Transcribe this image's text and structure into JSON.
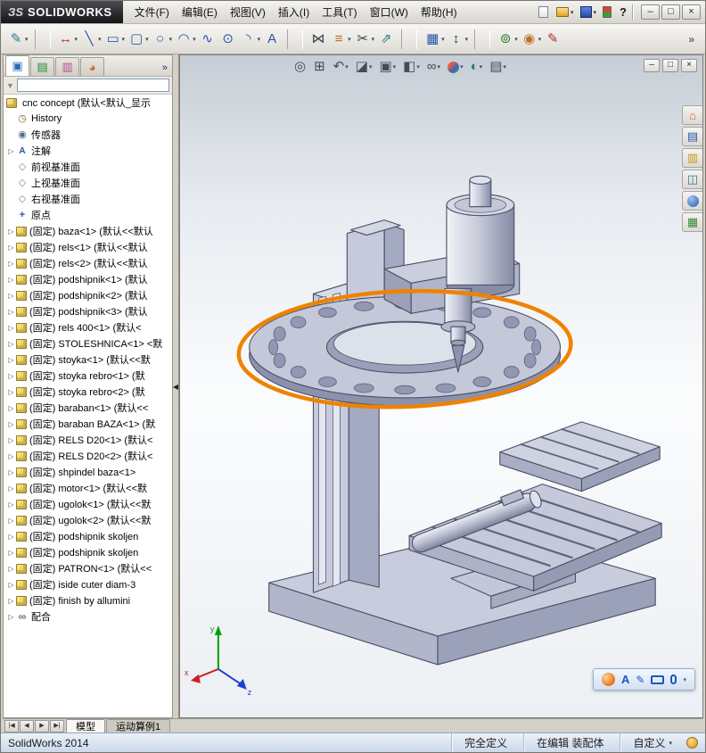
{
  "app": {
    "logo_mark": "ЗS",
    "logo_text": "SOLIDWORKS"
  },
  "menubar": {
    "items": [
      "文件(F)",
      "编辑(E)",
      "视图(V)",
      "插入(I)",
      "工具(T)",
      "窗口(W)",
      "帮助(H)"
    ]
  },
  "qat": {
    "items": [
      {
        "name": "new-document-button",
        "cls": "qi-page",
        "glyph": "",
        "dd": ""
      },
      {
        "name": "open-button",
        "cls": "qi-folder",
        "glyph": "",
        "dd": "▾"
      },
      {
        "name": "save-button",
        "cls": "qi-save",
        "glyph": "",
        "dd": "▾"
      },
      {
        "name": "options-toggle-button",
        "cls": "qi-toggle",
        "glyph": "",
        "dd": ""
      },
      {
        "name": "help-button",
        "cls": "qi-help",
        "glyph": "?",
        "dd": ""
      }
    ]
  },
  "window_controls": [
    {
      "name": "minimize-button",
      "glyph": "–"
    },
    {
      "name": "maximize-button",
      "glyph": "□"
    },
    {
      "name": "close-button",
      "glyph": "×"
    }
  ],
  "sketch_toolbar": {
    "overflow": "»",
    "items": [
      {
        "name": "sketch-button",
        "glyph": "✎",
        "arrow": "▾",
        "cls": "c-teal"
      },
      {
        "name": "separator",
        "glyph": "",
        "arrow": "",
        "cls": "tsepv"
      },
      {
        "name": "smart-dimension-button",
        "glyph": "↔",
        "arrow": "▾",
        "cls": "c-red"
      },
      {
        "name": "line-button",
        "glyph": "╲",
        "arrow": "▾",
        "cls": "c-blue"
      },
      {
        "name": "rectangle-button",
        "glyph": "▭",
        "arrow": "▾",
        "cls": "c-blue"
      },
      {
        "name": "slot-button",
        "glyph": "▢",
        "arrow": "▾",
        "cls": "c-blue"
      },
      {
        "name": "circle-button",
        "glyph": "○",
        "arrow": "▾",
        "cls": "c-blue"
      },
      {
        "name": "arc-button",
        "glyph": "◠",
        "arrow": "▾",
        "cls": "c-blue"
      },
      {
        "name": "spline-button",
        "glyph": "∿",
        "arrow": "",
        "cls": "c-blue"
      },
      {
        "name": "ellipse-button",
        "glyph": "⊙",
        "arrow": "",
        "cls": "c-blue"
      },
      {
        "name": "fillet-button",
        "glyph": "◝",
        "arrow": "▾",
        "cls": "c-blue"
      },
      {
        "name": "text-button",
        "glyph": "A",
        "arrow": "",
        "cls": "c-blue"
      },
      {
        "name": "separator",
        "glyph": "",
        "arrow": "",
        "cls": "tsepv"
      },
      {
        "name": "mirror-entities-button",
        "glyph": "⋈",
        "arrow": "",
        "cls": "c-dark"
      },
      {
        "name": "offset-entities-button",
        "glyph": "≡",
        "arrow": "▾",
        "cls": "c-orange"
      },
      {
        "name": "trim-entities-button",
        "glyph": "✂",
        "arrow": "▾",
        "cls": "c-dark"
      },
      {
        "name": "convert-entities-button",
        "glyph": "⇗",
        "arrow": "",
        "cls": "c-teal"
      },
      {
        "name": "separator",
        "glyph": "",
        "arrow": "",
        "cls": "tsepv"
      },
      {
        "name": "linear-pattern-button",
        "glyph": "▦",
        "arrow": "▾",
        "cls": "c-blue"
      },
      {
        "name": "move-entities-button",
        "glyph": "↕",
        "arrow": "▾",
        "cls": "c-dark"
      },
      {
        "name": "separator",
        "glyph": "",
        "arrow": "",
        "cls": "tsepv"
      },
      {
        "name": "display-relations-button",
        "glyph": "⊚",
        "arrow": "▾",
        "cls": "c-green"
      },
      {
        "name": "quick-snaps-button",
        "glyph": "◉",
        "arrow": "▾",
        "cls": "c-orange"
      },
      {
        "name": "rapid-sketch-button",
        "glyph": "✎",
        "arrow": "",
        "cls": "c-red"
      }
    ]
  },
  "panel": {
    "tabs_overflow": "»",
    "splitter_glyph": "◀",
    "filter_value": "",
    "funnel_glyph": "▼",
    "tabs": [
      {
        "name": "tab-featuremanager",
        "glyph": "▣",
        "cls": "pt-blue",
        "active": "active"
      },
      {
        "name": "tab-propertymanager",
        "glyph": "▤",
        "cls": "pt-green",
        "active": ""
      },
      {
        "name": "tab-configurationmanager",
        "glyph": "▥",
        "cls": "pt-pink",
        "active": ""
      },
      {
        "name": "tab-displaymanager",
        "glyph": "◕",
        "cls": "pt-orange",
        "active": ""
      }
    ]
  },
  "tree": {
    "root_label": "cnc concept (默认<默认_显示",
    "items": [
      {
        "exp": "noexp",
        "icon": "ic-history",
        "label": "History"
      },
      {
        "exp": "noexp",
        "icon": "ic-sensor",
        "label": "传感器"
      },
      {
        "exp": "exp",
        "icon": "ic-anno",
        "label": "注解"
      },
      {
        "exp": "noexp",
        "icon": "ic-plane",
        "label": "前视基准面"
      },
      {
        "exp": "noexp",
        "icon": "ic-plane",
        "label": "上视基准面"
      },
      {
        "exp": "noexp",
        "icon": "ic-plane",
        "label": "右视基准面"
      },
      {
        "exp": "noexp",
        "icon": "ic-origin",
        "label": "原点"
      },
      {
        "exp": "exp",
        "icon": "ic-part",
        "label": "(固定) baza<1> (默认<<默认"
      },
      {
        "exp": "exp",
        "icon": "ic-part",
        "label": "(固定) rels<1> (默认<<默认"
      },
      {
        "exp": "exp",
        "icon": "ic-part",
        "label": "(固定) rels<2> (默认<<默认"
      },
      {
        "exp": "exp",
        "icon": "ic-part",
        "label": "(固定) podshipnik<1> (默认"
      },
      {
        "exp": "exp",
        "icon": "ic-part",
        "label": "(固定) podshipnik<2> (默认"
      },
      {
        "exp": "exp",
        "icon": "ic-part",
        "label": "(固定) podshipnik<3> (默认"
      },
      {
        "exp": "exp",
        "icon": "ic-part",
        "label": "(固定) rels 400<1> (默认<"
      },
      {
        "exp": "exp",
        "icon": "ic-part",
        "label": "(固定) STOLESHNICA<1> <默"
      },
      {
        "exp": "exp",
        "icon": "ic-part",
        "label": "(固定) stoyka<1> (默认<<默"
      },
      {
        "exp": "exp",
        "icon": "ic-part",
        "label": "(固定) stoyka rebro<1> (默"
      },
      {
        "exp": "exp",
        "icon": "ic-part",
        "label": "(固定) stoyka rebro<2> (默"
      },
      {
        "exp": "exp",
        "icon": "ic-part",
        "label": "(固定) baraban<1> (默认<<"
      },
      {
        "exp": "exp",
        "icon": "ic-part",
        "label": "(固定) baraban BAZA<1> (默"
      },
      {
        "exp": "exp",
        "icon": "ic-part",
        "label": "(固定) RELS D20<1> (默认<"
      },
      {
        "exp": "exp",
        "icon": "ic-part",
        "label": "(固定) RELS D20<2> (默认<"
      },
      {
        "exp": "exp",
        "icon": "ic-part",
        "label": "(固定) shpindel baza<1>"
      },
      {
        "exp": "exp",
        "icon": "ic-part",
        "label": "(固定) motor<1> (默认<<默"
      },
      {
        "exp": "exp",
        "icon": "ic-part",
        "label": "(固定) ugolok<1> (默认<<默"
      },
      {
        "exp": "exp",
        "icon": "ic-part",
        "label": "(固定) ugolok<2> (默认<<默"
      },
      {
        "exp": "exp",
        "icon": "ic-part",
        "label": "(固定) podshipnik skoljen"
      },
      {
        "exp": "exp",
        "icon": "ic-part",
        "label": "(固定) podshipnik skoljen"
      },
      {
        "exp": "exp",
        "icon": "ic-part",
        "label": "(固定) PATRON<1> (默认<<"
      },
      {
        "exp": "exp",
        "icon": "ic-part",
        "label": "(固定) iside cuter diam-3"
      },
      {
        "exp": "exp",
        "icon": "ic-part",
        "label": "(固定) finish by allumini"
      },
      {
        "exp": "exp",
        "icon": "ic-mates",
        "label": "配合"
      }
    ]
  },
  "viewport_toolbar": {
    "items": [
      {
        "name": "zoom-fit-button",
        "glyph": "◎",
        "arrow": "",
        "cls": "c-steel"
      },
      {
        "name": "zoom-area-button",
        "glyph": "⊞",
        "arrow": "",
        "cls": "c-steel"
      },
      {
        "name": "previous-view-button",
        "glyph": "↶",
        "arrow": "▾",
        "cls": "c-steel"
      },
      {
        "name": "section-view-button",
        "glyph": "◪",
        "arrow": "▾",
        "cls": "c-steel"
      },
      {
        "name": "view-orientation-button",
        "glyph": "▣",
        "arrow": "▾",
        "cls": "c-steel"
      },
      {
        "name": "display-style-button",
        "glyph": "◧",
        "arrow": "▾",
        "cls": "c-steel"
      },
      {
        "name": "hide-show-items-button",
        "glyph": "∞",
        "arrow": "▾",
        "cls": "c-steel"
      },
      {
        "name": "edit-appearance-button",
        "glyph": "",
        "arrow": "▾",
        "cls": "vball"
      },
      {
        "name": "apply-scene-button",
        "glyph": "◐",
        "arrow": "▾",
        "cls": "c-teal"
      },
      {
        "name": "view-settings-button",
        "glyph": "▤",
        "arrow": "▾",
        "cls": "c-steel"
      }
    ]
  },
  "doc_controls": [
    {
      "name": "doc-minimize-button",
      "glyph": "–"
    },
    {
      "name": "doc-restore-button",
      "glyph": "□"
    },
    {
      "name": "doc-close-button",
      "glyph": "×"
    }
  ],
  "task_pane": {
    "items": [
      {
        "name": "task-resources",
        "glyph": "⌂",
        "cls": "tp-orange"
      },
      {
        "name": "task-design-library",
        "glyph": "▤",
        "cls": "tp-blue"
      },
      {
        "name": "task-file-explorer",
        "glyph": "▥",
        "cls": "tp-yellow"
      },
      {
        "name": "task-view-palette",
        "glyph": "◫",
        "cls": "tp-teal"
      },
      {
        "name": "task-appearances",
        "glyph": "",
        "cls": "tp-ball"
      },
      {
        "name": "task-custom-properties",
        "glyph": "▦",
        "cls": "tp-green"
      }
    ]
  },
  "ime": {
    "items": [
      {
        "name": "ime-logo",
        "cls": "ime-logo",
        "glyph": ""
      },
      {
        "name": "ime-english-toggle",
        "cls": "ime-a",
        "glyph": "A"
      },
      {
        "name": "ime-handwriting",
        "cls": "ime-pen",
        "glyph": "✎"
      },
      {
        "name": "ime-keyboard",
        "cls": "ime-kb",
        "glyph": ""
      },
      {
        "name": "ime-microphone",
        "cls": "ime-mic",
        "glyph": ""
      },
      {
        "name": "ime-menu",
        "cls": "ime-dd",
        "glyph": "▾"
      }
    ]
  },
  "doc_tabs": {
    "nav": [
      {
        "name": "tab-scroll-first",
        "glyph": "|◀"
      },
      {
        "name": "tab-scroll-left",
        "glyph": "◀"
      },
      {
        "name": "tab-scroll-right",
        "glyph": "▶"
      },
      {
        "name": "tab-scroll-last",
        "glyph": "▶|"
      }
    ],
    "tabs": [
      {
        "label": "模型",
        "cls": "active"
      },
      {
        "label": "运动算例1",
        "cls": ""
      }
    ]
  },
  "status_bar": {
    "left": "SolidWorks 2014",
    "fields": [
      {
        "label": "完全定义",
        "dd": ""
      },
      {
        "label": "在编辑 装配体",
        "dd": ""
      },
      {
        "label": "自定义",
        "dd": "▾"
      }
    ]
  },
  "triad": {
    "x": "x",
    "y": "y",
    "z": "z"
  },
  "model": {
    "highlight_color": "#f08200"
  }
}
